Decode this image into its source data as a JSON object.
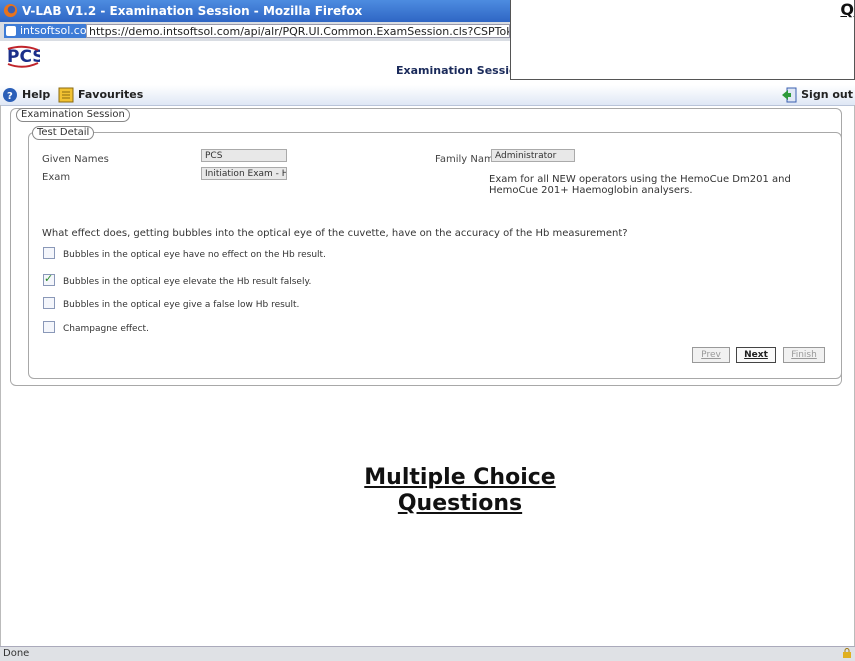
{
  "window": {
    "title": "V-LAB V1.2 - Examination Session - Mozilla Firefox"
  },
  "addressbar": {
    "site": "intsoftsol.com",
    "url": "https://demo.intsoftsol.com/api/alr/PQR.UI.Common.ExamSession.cls?CSPToken=LOZerdOEgsXzCp"
  },
  "header": {
    "page_title": "Examination Session"
  },
  "overlay": {
    "cut_text": "Q"
  },
  "toolbar": {
    "help": "Help",
    "favourites": "Favourites",
    "signout": "Sign out"
  },
  "session": {
    "legend": "Examination Session",
    "test_detail_legend": "Test Detail",
    "given_names_label": "Given Names",
    "given_names_value": "PCS",
    "family_name_label": "Family Name",
    "family_name_value": "Administrator",
    "exam_label": "Exam",
    "exam_value": "Initiation Exam - Hem",
    "exam_description": "Exam for all NEW operators using the HemoCue Dm201 and HemoCue 201+ Haemoglobin analysers."
  },
  "question": {
    "text": "What effect does, getting bubbles into the optical eye of the cuvette, have on the accuracy of the Hb measurement?",
    "options": [
      {
        "label": "Bubbles in the optical eye have no effect on the Hb result.",
        "checked": false
      },
      {
        "label": "Bubbles in the optical eye elevate the Hb result falsely.",
        "checked": true
      },
      {
        "label": "Bubbles in the optical eye give a false low Hb result.",
        "checked": false
      },
      {
        "label": "Champagne effect.",
        "checked": false
      }
    ]
  },
  "nav": {
    "prev": "Prev",
    "next": "Next",
    "finish": "Finish"
  },
  "caption": {
    "line1": "Multiple Choice",
    "line2": "Questions"
  },
  "status": {
    "text": "Done"
  },
  "colors": {
    "titlebar": "#2f66c4",
    "checkmark": "#2a8a2a",
    "site_badge": "#3d7bd6"
  }
}
